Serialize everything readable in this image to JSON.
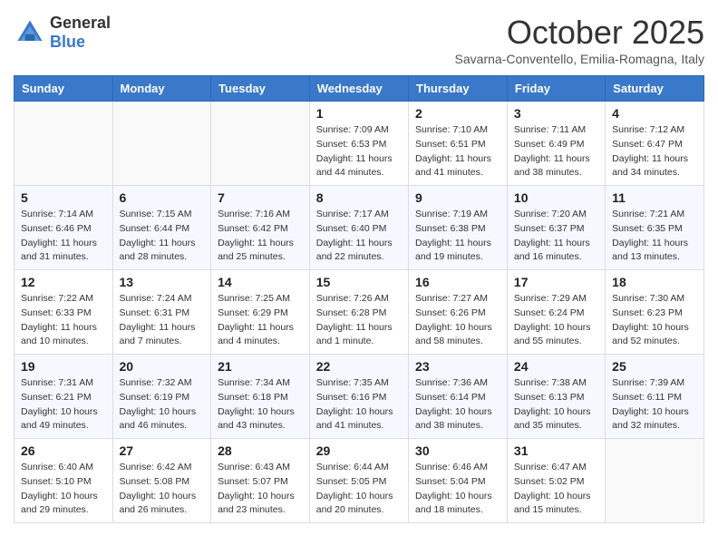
{
  "header": {
    "logo": {
      "text_general": "General",
      "text_blue": "Blue"
    },
    "title": "October 2025",
    "subtitle": "Savarna-Conventello, Emilia-Romagna, Italy"
  },
  "calendar": {
    "days_of_week": [
      "Sunday",
      "Monday",
      "Tuesday",
      "Wednesday",
      "Thursday",
      "Friday",
      "Saturday"
    ],
    "weeks": [
      [
        {
          "day": "",
          "info": ""
        },
        {
          "day": "",
          "info": ""
        },
        {
          "day": "",
          "info": ""
        },
        {
          "day": "1",
          "info": "Sunrise: 7:09 AM\nSunset: 6:53 PM\nDaylight: 11 hours\nand 44 minutes."
        },
        {
          "day": "2",
          "info": "Sunrise: 7:10 AM\nSunset: 6:51 PM\nDaylight: 11 hours\nand 41 minutes."
        },
        {
          "day": "3",
          "info": "Sunrise: 7:11 AM\nSunset: 6:49 PM\nDaylight: 11 hours\nand 38 minutes."
        },
        {
          "day": "4",
          "info": "Sunrise: 7:12 AM\nSunset: 6:47 PM\nDaylight: 11 hours\nand 34 minutes."
        }
      ],
      [
        {
          "day": "5",
          "info": "Sunrise: 7:14 AM\nSunset: 6:46 PM\nDaylight: 11 hours\nand 31 minutes."
        },
        {
          "day": "6",
          "info": "Sunrise: 7:15 AM\nSunset: 6:44 PM\nDaylight: 11 hours\nand 28 minutes."
        },
        {
          "day": "7",
          "info": "Sunrise: 7:16 AM\nSunset: 6:42 PM\nDaylight: 11 hours\nand 25 minutes."
        },
        {
          "day": "8",
          "info": "Sunrise: 7:17 AM\nSunset: 6:40 PM\nDaylight: 11 hours\nand 22 minutes."
        },
        {
          "day": "9",
          "info": "Sunrise: 7:19 AM\nSunset: 6:38 PM\nDaylight: 11 hours\nand 19 minutes."
        },
        {
          "day": "10",
          "info": "Sunrise: 7:20 AM\nSunset: 6:37 PM\nDaylight: 11 hours\nand 16 minutes."
        },
        {
          "day": "11",
          "info": "Sunrise: 7:21 AM\nSunset: 6:35 PM\nDaylight: 11 hours\nand 13 minutes."
        }
      ],
      [
        {
          "day": "12",
          "info": "Sunrise: 7:22 AM\nSunset: 6:33 PM\nDaylight: 11 hours\nand 10 minutes."
        },
        {
          "day": "13",
          "info": "Sunrise: 7:24 AM\nSunset: 6:31 PM\nDaylight: 11 hours\nand 7 minutes."
        },
        {
          "day": "14",
          "info": "Sunrise: 7:25 AM\nSunset: 6:29 PM\nDaylight: 11 hours\nand 4 minutes."
        },
        {
          "day": "15",
          "info": "Sunrise: 7:26 AM\nSunset: 6:28 PM\nDaylight: 11 hours\nand 1 minute."
        },
        {
          "day": "16",
          "info": "Sunrise: 7:27 AM\nSunset: 6:26 PM\nDaylight: 10 hours\nand 58 minutes."
        },
        {
          "day": "17",
          "info": "Sunrise: 7:29 AM\nSunset: 6:24 PM\nDaylight: 10 hours\nand 55 minutes."
        },
        {
          "day": "18",
          "info": "Sunrise: 7:30 AM\nSunset: 6:23 PM\nDaylight: 10 hours\nand 52 minutes."
        }
      ],
      [
        {
          "day": "19",
          "info": "Sunrise: 7:31 AM\nSunset: 6:21 PM\nDaylight: 10 hours\nand 49 minutes."
        },
        {
          "day": "20",
          "info": "Sunrise: 7:32 AM\nSunset: 6:19 PM\nDaylight: 10 hours\nand 46 minutes."
        },
        {
          "day": "21",
          "info": "Sunrise: 7:34 AM\nSunset: 6:18 PM\nDaylight: 10 hours\nand 43 minutes."
        },
        {
          "day": "22",
          "info": "Sunrise: 7:35 AM\nSunset: 6:16 PM\nDaylight: 10 hours\nand 41 minutes."
        },
        {
          "day": "23",
          "info": "Sunrise: 7:36 AM\nSunset: 6:14 PM\nDaylight: 10 hours\nand 38 minutes."
        },
        {
          "day": "24",
          "info": "Sunrise: 7:38 AM\nSunset: 6:13 PM\nDaylight: 10 hours\nand 35 minutes."
        },
        {
          "day": "25",
          "info": "Sunrise: 7:39 AM\nSunset: 6:11 PM\nDaylight: 10 hours\nand 32 minutes."
        }
      ],
      [
        {
          "day": "26",
          "info": "Sunrise: 6:40 AM\nSunset: 5:10 PM\nDaylight: 10 hours\nand 29 minutes."
        },
        {
          "day": "27",
          "info": "Sunrise: 6:42 AM\nSunset: 5:08 PM\nDaylight: 10 hours\nand 26 minutes."
        },
        {
          "day": "28",
          "info": "Sunrise: 6:43 AM\nSunset: 5:07 PM\nDaylight: 10 hours\nand 23 minutes."
        },
        {
          "day": "29",
          "info": "Sunrise: 6:44 AM\nSunset: 5:05 PM\nDaylight: 10 hours\nand 20 minutes."
        },
        {
          "day": "30",
          "info": "Sunrise: 6:46 AM\nSunset: 5:04 PM\nDaylight: 10 hours\nand 18 minutes."
        },
        {
          "day": "31",
          "info": "Sunrise: 6:47 AM\nSunset: 5:02 PM\nDaylight: 10 hours\nand 15 minutes."
        },
        {
          "day": "",
          "info": ""
        }
      ]
    ]
  }
}
